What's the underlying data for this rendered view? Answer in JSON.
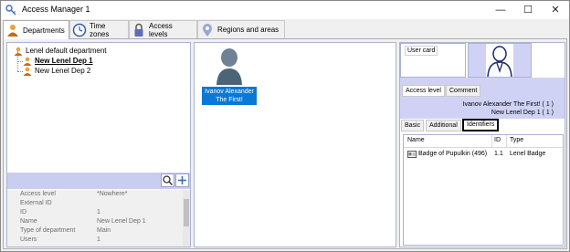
{
  "window": {
    "title": "Access Manager 1"
  },
  "controls": {
    "minimize": "—",
    "maximize": "☐",
    "close": "✕"
  },
  "tabs": [
    {
      "label": "Departments",
      "icon": "people-icon",
      "active": true
    },
    {
      "label": "Time zones",
      "icon": "clock-icon",
      "active": false
    },
    {
      "label": "Access levels",
      "icon": "lock-icon",
      "active": false
    },
    {
      "label": "Regions and areas",
      "icon": "map-pin-icon",
      "active": false
    }
  ],
  "tree": {
    "items": [
      {
        "label": "Lenel default department",
        "selected": false
      },
      {
        "label": "New Lenel Dep 1",
        "selected": true
      },
      {
        "label": "New Lenel Dep 2",
        "selected": false
      }
    ]
  },
  "properties": [
    {
      "key": "Access level",
      "value": "*Nowhere*"
    },
    {
      "key": "External ID",
      "value": ""
    },
    {
      "key": "ID",
      "value": "1"
    },
    {
      "key": "Name",
      "value": "New Lenel Dep 1"
    },
    {
      "key": "Type of department",
      "value": "Main"
    },
    {
      "key": "Users",
      "value": "1"
    }
  ],
  "employee": {
    "name_line1": "Ivanov Alexander",
    "name_line2": "The First!"
  },
  "right": {
    "user_card_label": "User card",
    "subtabs": [
      "Access level",
      "Comment"
    ],
    "info_line1": "Ivanov Alexander The First! ( 1 )",
    "info_line2": "New Lenel Dep 1 ( 1 )",
    "bottom_tabs": [
      "Basic",
      "Additional",
      "Identifiers"
    ],
    "grid": {
      "headers": [
        "Name",
        "ID",
        "Type"
      ],
      "rows": [
        {
          "name": "Badge of Pupulkin (496)",
          "id": "1.1",
          "type": "Lenel Badge"
        }
      ]
    }
  },
  "colors": {
    "accent_blue": "#0a78d7",
    "panel_lavender": "#d0d2f5",
    "toolbar_blue": "#c9cef0"
  }
}
